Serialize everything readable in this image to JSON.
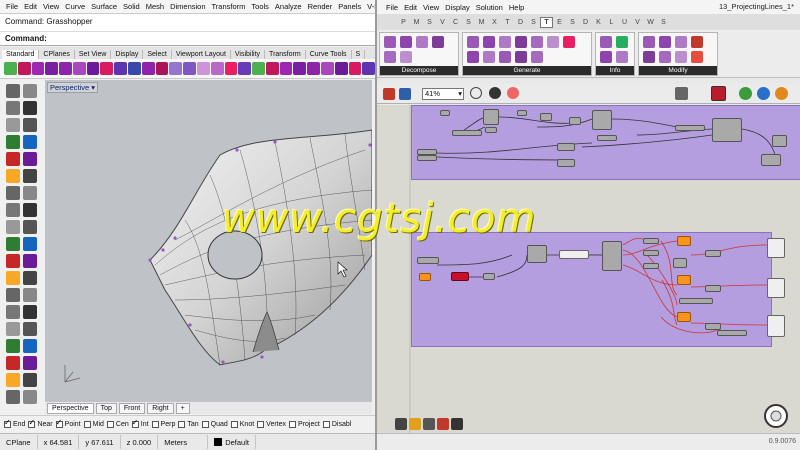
{
  "rhino": {
    "menu": [
      "File",
      "Edit",
      "View",
      "Curve",
      "Surface",
      "Solid",
      "Mesh",
      "Dimension",
      "Transform",
      "Tools",
      "Analyze",
      "Render",
      "Panels",
      "V-Ray"
    ],
    "command_history": "Command: Grasshopper",
    "command_prompt": "Command:",
    "toolbar_tabs": [
      "Standard",
      "CPlanes",
      "Set View",
      "Display",
      "Select",
      "Viewport Layout",
      "Visibility",
      "Transform",
      "Curve Tools",
      "S"
    ],
    "viewport_label": "Perspective",
    "viewport_tabs": [
      "Perspective",
      "Top",
      "Front",
      "Right"
    ],
    "viewport_add": "+",
    "osnaps": [
      {
        "label": "End",
        "checked": true
      },
      {
        "label": "Near",
        "checked": true
      },
      {
        "label": "Point",
        "checked": true
      },
      {
        "label": "Mid",
        "checked": false
      },
      {
        "label": "Cen",
        "checked": false
      },
      {
        "label": "Int",
        "checked": true
      },
      {
        "label": "Perp",
        "checked": false
      },
      {
        "label": "Tan",
        "checked": false
      },
      {
        "label": "Quad",
        "checked": false
      },
      {
        "label": "Knot",
        "checked": false
      },
      {
        "label": "Vertex",
        "checked": false
      },
      {
        "label": "Project",
        "checked": false
      },
      {
        "label": "Disabl",
        "checked": false
      }
    ],
    "status": {
      "cplane": "CPlane",
      "x": "x 64.581",
      "y": "y 67.611",
      "z": "z 0.000",
      "units": "Meters",
      "layer": "Default"
    }
  },
  "grasshopper": {
    "menu": [
      "File",
      "Edit",
      "View",
      "Display",
      "Solution",
      "Help"
    ],
    "title": "13_ProjectingLines_1*",
    "category_tabs": [
      "P",
      "M",
      "S",
      "V",
      "C",
      "S",
      "M",
      "X",
      "T",
      "D",
      "S",
      "T",
      "E",
      "S",
      "D",
      "K",
      "L",
      "U",
      "V",
      "W",
      "S"
    ],
    "active_category_index": 11,
    "ribbon_panels": [
      "Decompose",
      "Generate",
      "Info",
      "Modify"
    ],
    "zoom": "41%",
    "version": "0.9.0076"
  },
  "watermark": "www.cgtsj.com",
  "colors": {
    "group_fill": "#b49ee0",
    "param_orange": "#f7941d",
    "param_red": "#c8102e",
    "watermark": "#f4ee2a"
  }
}
